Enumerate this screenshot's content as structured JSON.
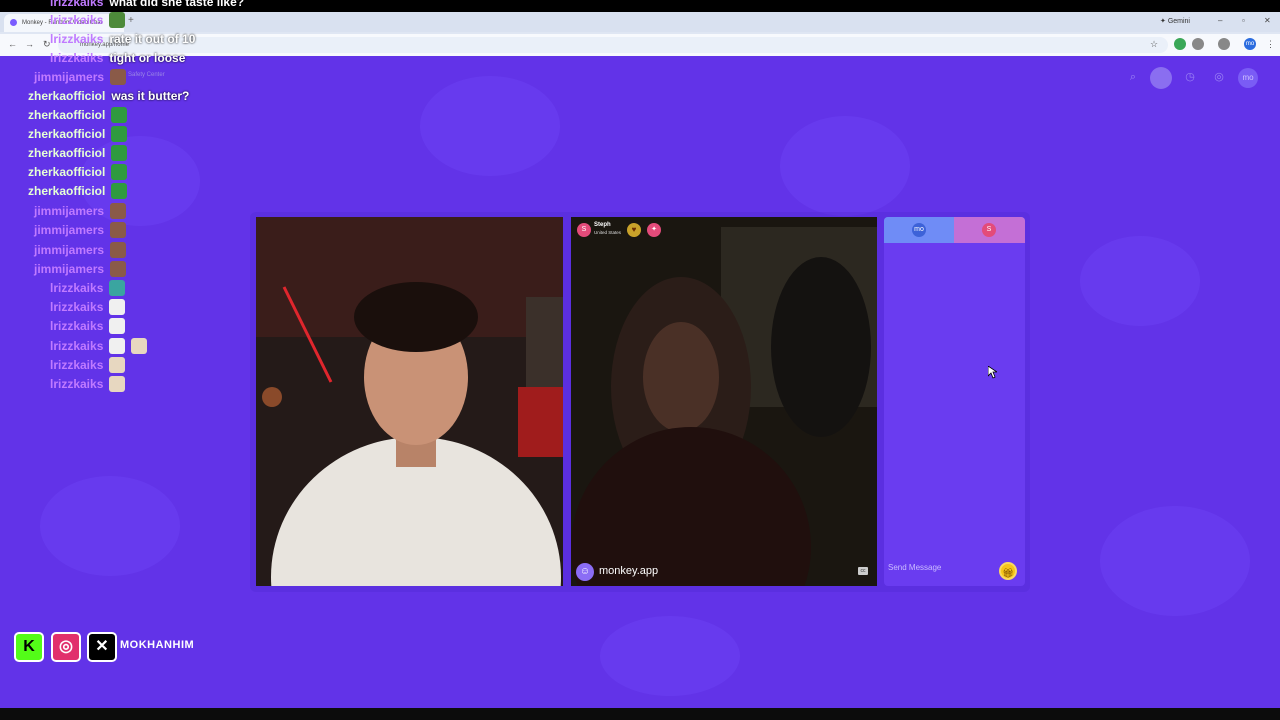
{
  "browser": {
    "tab_title": "Monkey - Random Video Chat",
    "new_tab": "+",
    "url": "monkey.app/home",
    "gemini": "Gemini",
    "extension_avatar": "mo"
  },
  "app": {
    "help_text": "Safety Center",
    "top_avatar_label": "mo",
    "stranger": {
      "avatar_initial": "S",
      "name": "Steph",
      "country": "United States"
    },
    "watermark": "monkey.app",
    "chat": {
      "tab_me": "mo",
      "tab_stranger": "S",
      "input_placeholder": "Send Message"
    },
    "colors": {
      "background": "#6233e8",
      "chat_panel": "#6a3cf0",
      "gift_button": "#f5c518"
    }
  },
  "stream_chat": [
    {
      "user": "lrizzkaiks",
      "color": "#c07aff",
      "message": "what did she taste like?",
      "emotes": []
    },
    {
      "user": "lrizzkaiks",
      "color": "#c07aff",
      "message": "",
      "emotes": [
        "pepe-emote"
      ]
    },
    {
      "user": "lrizzkaiks",
      "color": "#c07aff",
      "message": "rate it out of 10",
      "emotes": []
    },
    {
      "user": "lrizzkaiks",
      "color": "#c07aff",
      "message": "tight or loose",
      "emotes": []
    },
    {
      "user": "jimmijamers",
      "color": "#c07aff",
      "message": "",
      "emotes": [
        "face-emote"
      ]
    },
    {
      "user": "zherkaofficiol",
      "color": "#e6ffd6",
      "message": "was it butter?",
      "emotes": []
    },
    {
      "user": "zherkaofficiol",
      "color": "#e6ffd6",
      "message": "",
      "emotes": [
        "green-emote"
      ]
    },
    {
      "user": "zherkaofficiol",
      "color": "#e6ffd6",
      "message": "",
      "emotes": [
        "green-emote"
      ]
    },
    {
      "user": "zherkaofficiol",
      "color": "#e6ffd6",
      "message": "",
      "emotes": [
        "green-emote"
      ]
    },
    {
      "user": "zherkaofficiol",
      "color": "#e6ffd6",
      "message": "",
      "emotes": [
        "green-emote"
      ]
    },
    {
      "user": "zherkaofficiol",
      "color": "#e6ffd6",
      "message": "",
      "emotes": [
        "green-emote"
      ]
    },
    {
      "user": "jimmijamers",
      "color": "#c07aff",
      "message": "",
      "emotes": [
        "face-emote"
      ]
    },
    {
      "user": "jimmijamers",
      "color": "#c07aff",
      "message": "",
      "emotes": [
        "face-emote"
      ]
    },
    {
      "user": "jimmijamers",
      "color": "#c07aff",
      "message": "",
      "emotes": [
        "face-emote"
      ]
    },
    {
      "user": "jimmijamers",
      "color": "#c07aff",
      "message": "",
      "emotes": [
        "face-emote"
      ]
    },
    {
      "user": "lrizzkaiks",
      "color": "#c07aff",
      "message": "",
      "emotes": [
        "teal-emote"
      ]
    },
    {
      "user": "lrizzkaiks",
      "color": "#c07aff",
      "message": "",
      "emotes": [
        "ghost-emote"
      ]
    },
    {
      "user": "lrizzkaiks",
      "color": "#c07aff",
      "message": "",
      "emotes": [
        "ghost-emote"
      ]
    },
    {
      "user": "lrizzkaiks",
      "color": "#c07aff",
      "message": "",
      "emotes": [
        "ghost-emote",
        "cat-emote"
      ]
    },
    {
      "user": "lrizzkaiks",
      "color": "#c07aff",
      "message": "",
      "emotes": [
        "cat-emote"
      ]
    },
    {
      "user": "lrizzkaiks",
      "color": "#c07aff",
      "message": "",
      "emotes": [
        "cat-emote"
      ]
    }
  ],
  "socials": {
    "kick_label": "K",
    "handle": "MOKHANHIM"
  }
}
